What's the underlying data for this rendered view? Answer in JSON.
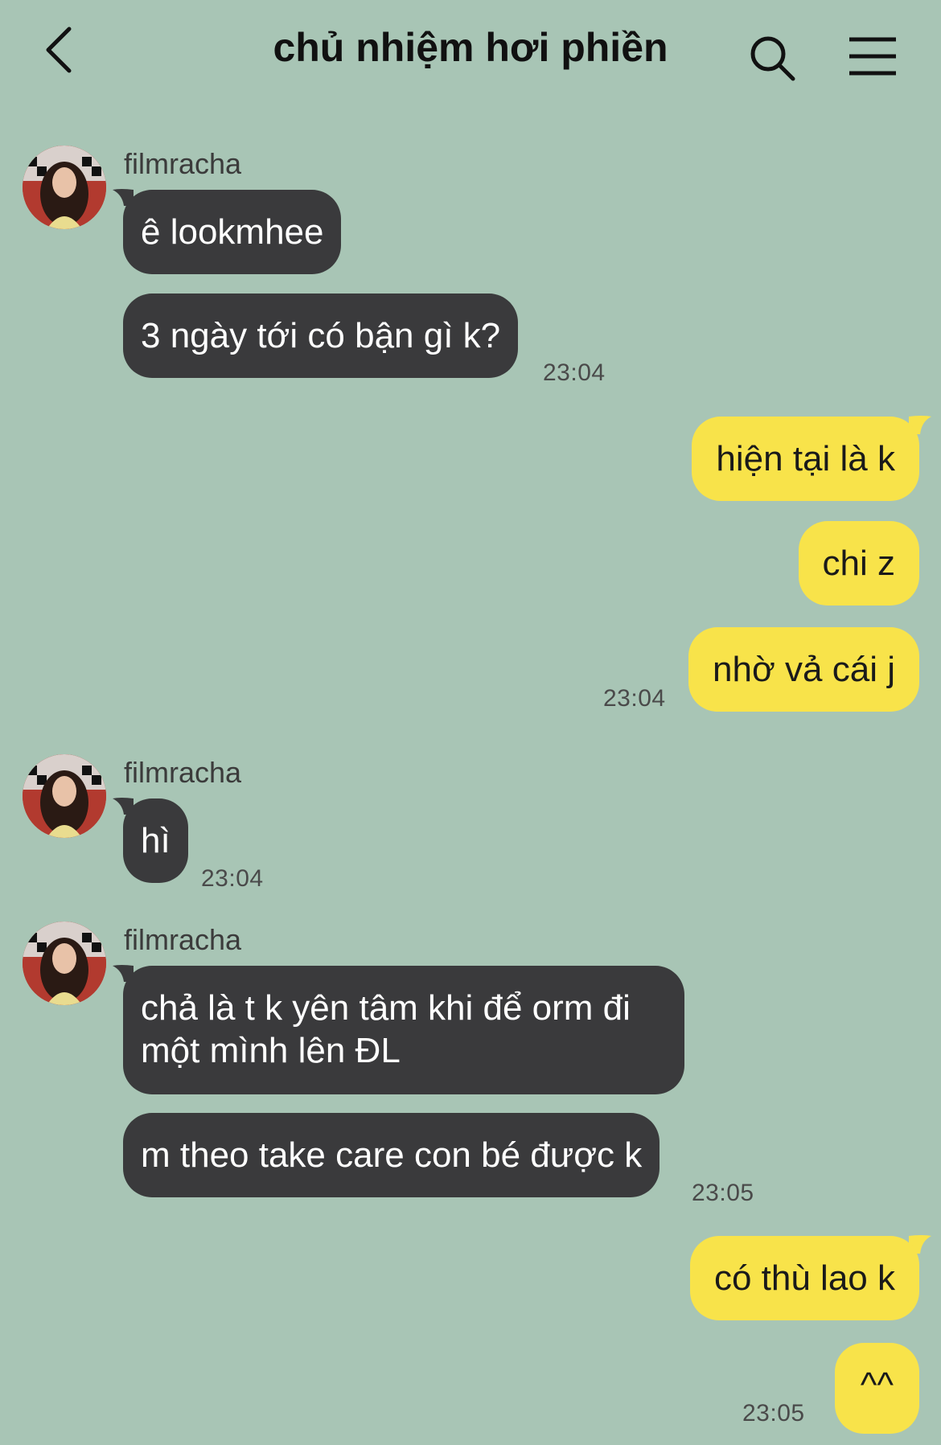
{
  "header": {
    "title": "chủ nhiệm hơi phiền",
    "back_icon": "chevron-left-icon",
    "search_icon": "search-icon",
    "menu_icon": "hamburger-menu-icon"
  },
  "colors": {
    "background": "#a8c5b5",
    "incoming_bubble": "#3a3a3c",
    "outgoing_bubble": "#f8e34a"
  },
  "groups": [
    {
      "sender": "filmracha",
      "messages": [
        "ê lookmhee",
        "3 ngày tới có bận gì k?"
      ],
      "time": "23:04"
    },
    {
      "sender": "me",
      "messages": [
        "hiện tại là k",
        "chi z",
        "nhờ vả cái j"
      ],
      "time": "23:04"
    },
    {
      "sender": "filmracha",
      "messages": [
        "hì"
      ],
      "time": "23:04"
    },
    {
      "sender": "filmracha",
      "messages": [
        "chả là t k yên tâm khi để orm đi một mình lên ĐL",
        "m theo take care con bé được k"
      ],
      "time": "23:05"
    },
    {
      "sender": "me",
      "messages": [
        "có thù lao k",
        "^^"
      ],
      "time": "23:05"
    }
  ]
}
